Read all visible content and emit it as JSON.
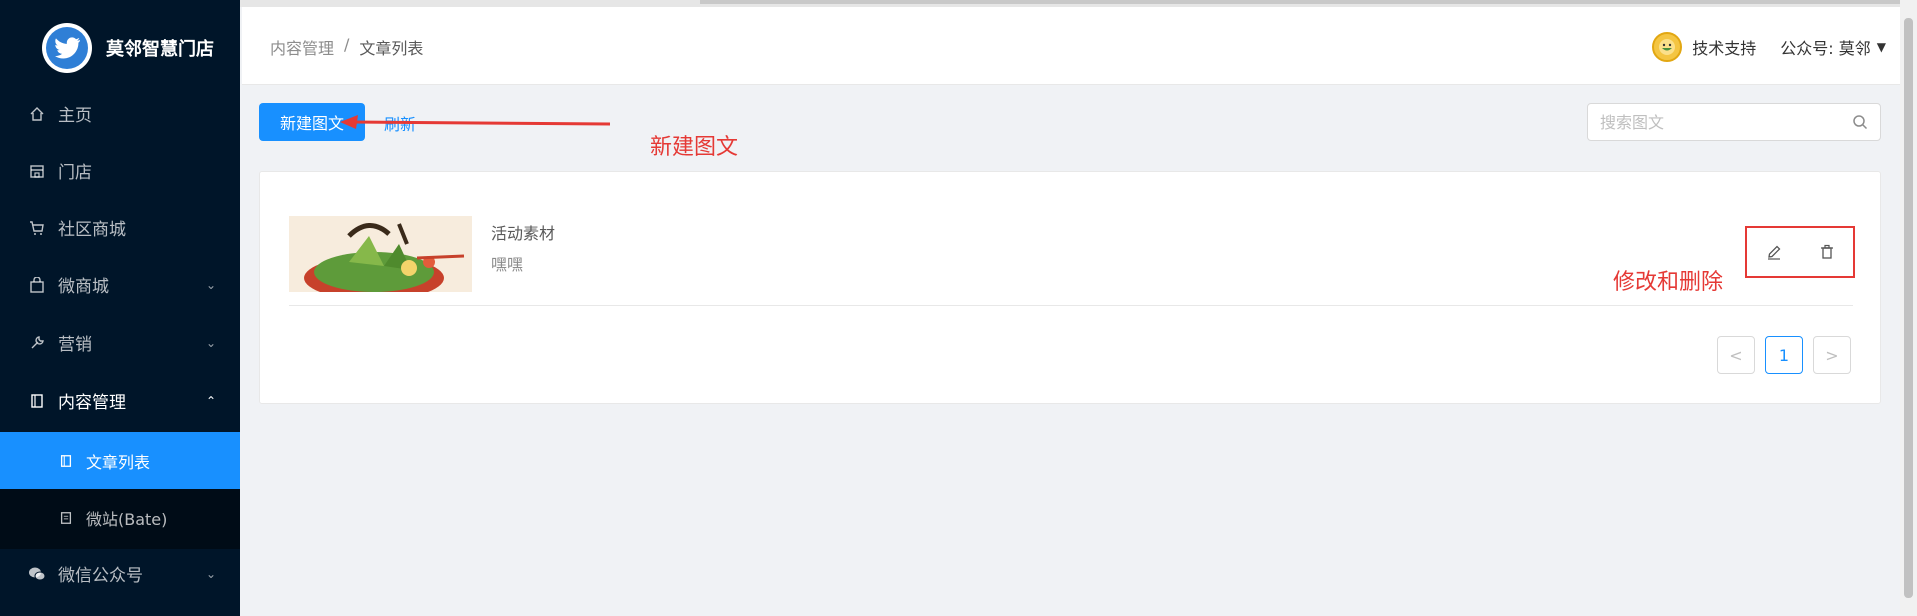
{
  "app": {
    "name": "莫邻智慧门店"
  },
  "sidebar": {
    "items": [
      {
        "label": "主页",
        "icon": "home-icon"
      },
      {
        "label": "门店",
        "icon": "store-icon"
      },
      {
        "label": "社区商城",
        "icon": "cart-icon"
      },
      {
        "label": "微商城",
        "icon": "bag-icon"
      },
      {
        "label": "营销",
        "icon": "wrench-icon"
      },
      {
        "label": "内容管理",
        "icon": "book-icon"
      },
      {
        "label": "微信公众号",
        "icon": "wechat-icon"
      }
    ],
    "submenu": [
      {
        "label": "文章列表",
        "icon": "book-icon"
      },
      {
        "label": "微站(Bate)",
        "icon": "page-icon"
      }
    ]
  },
  "header": {
    "breadcrumb": [
      "内容管理",
      "/",
      "文章列表"
    ],
    "support": "技术支持",
    "account": "公众号: 莫邻"
  },
  "toolbar": {
    "new_label": "新建图文",
    "refresh_label": "刷新",
    "search_placeholder": "搜索图文"
  },
  "articles": [
    {
      "title": "活动素材",
      "desc": "嘿嘿"
    }
  ],
  "pagination": {
    "prev": "<",
    "current": "1",
    "next": ">"
  },
  "annotations": {
    "new": "新建图文",
    "edit_delete": "修改和删除"
  },
  "colors": {
    "sidebar": "#001529",
    "accent": "#1890ff",
    "annotation": "#e53935"
  }
}
